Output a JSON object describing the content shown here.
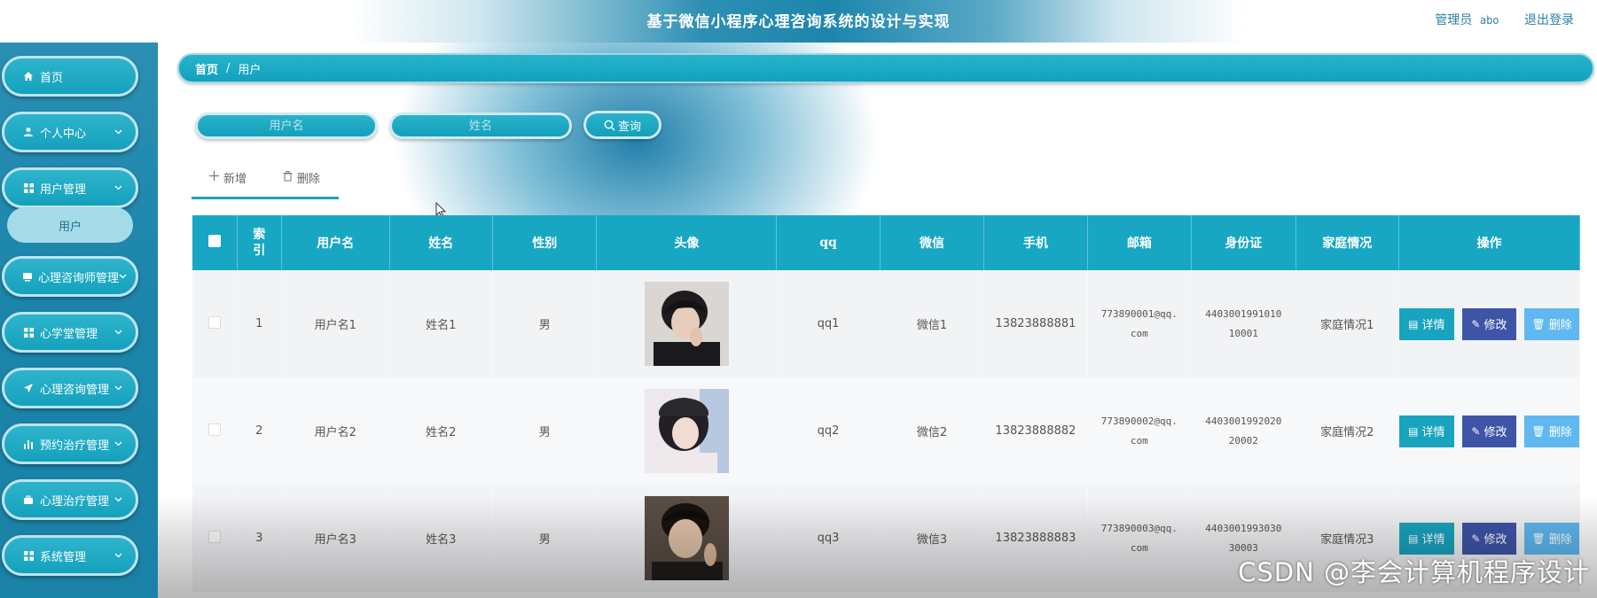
{
  "header": {
    "title": "基于微信小程序心理咨询系统的设计与实现",
    "role": "管理员",
    "username": "abo",
    "logout": "退出登录"
  },
  "sidebar": {
    "items": [
      {
        "label": "首页",
        "icon": "home-icon"
      },
      {
        "label": "个人中心",
        "icon": "user-icon"
      },
      {
        "label": "用户管理",
        "icon": "grid-icon"
      },
      {
        "label": "心理咨询师管理",
        "icon": "card-icon"
      },
      {
        "label": "心学堂管理",
        "icon": "grid-icon"
      },
      {
        "label": "心理咨询管理",
        "icon": "send-icon"
      },
      {
        "label": "预约治疗管理",
        "icon": "bar-chart-icon"
      },
      {
        "label": "心理治疗管理",
        "icon": "briefcase-icon"
      },
      {
        "label": "系统管理",
        "icon": "grid-icon"
      }
    ],
    "active_sub": "用户"
  },
  "breadcrumb": {
    "home": "首页",
    "sep": "/",
    "current": "用户"
  },
  "search": {
    "username_placeholder": "用户名",
    "name_placeholder": "姓名",
    "button": "查询"
  },
  "actions": {
    "add": "新增",
    "delete": "删除"
  },
  "table": {
    "headers": [
      "索引",
      "用户名",
      "姓名",
      "性别",
      "头像",
      "qq",
      "微信",
      "手机",
      "邮箱",
      "身份证",
      "家庭情况",
      "操作"
    ],
    "rows": [
      {
        "index": "1",
        "username": "用户名1",
        "name": "姓名1",
        "gender": "男",
        "qq": "qq1",
        "wechat": "微信1",
        "phone": "13823888881",
        "email_a": "773890001@qq.",
        "email_b": "com",
        "id_a": "4403001991010",
        "id_b": "10001",
        "family": "家庭情况1"
      },
      {
        "index": "2",
        "username": "用户名2",
        "name": "姓名2",
        "gender": "男",
        "qq": "qq2",
        "wechat": "微信2",
        "phone": "13823888882",
        "email_a": "773890002@qq.",
        "email_b": "com",
        "id_a": "4403001992020",
        "id_b": "20002",
        "family": "家庭情况2"
      },
      {
        "index": "3",
        "username": "用户名3",
        "name": "姓名3",
        "gender": "男",
        "qq": "qq3",
        "wechat": "微信3",
        "phone": "13823888883",
        "email_a": "773890003@qq.",
        "email_b": "com",
        "id_a": "4403001993030",
        "id_b": "30003",
        "family": "家庭情况3"
      }
    ],
    "op_detail": "详情",
    "op_edit": "修改",
    "op_delete": "删除"
  },
  "watermark": "CSDN @李会计算机程序设计",
  "colors": {
    "accent": "#17a7c3",
    "sidebar": "#1b84aa",
    "edit": "#3e55a7",
    "delete": "#5fb8f0"
  }
}
